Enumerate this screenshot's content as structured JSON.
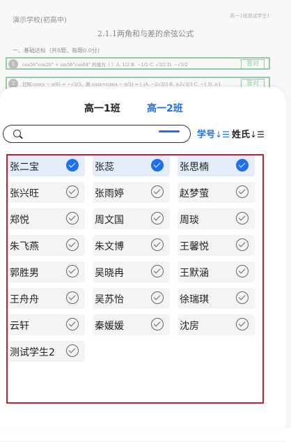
{
  "document": {
    "school": "演示学校(初高中)",
    "tag": "高一1班测试学生1",
    "title": "2.1.1两角和与差的余弦公式",
    "section": "一、基础达标（共8题，每题0.0分）",
    "questions": [
      {
        "num": "1",
        "text": "cos56°cos26° + sin56°cos64° 的值为（ ）A. 1/2  B. −1/2  C. √3/2  D. −√3/2",
        "answer": "答对"
      },
      {
        "num": "2",
        "text": "已知 cos(x − π/6) = −√3/3，则 cosx+cos(x − π/3) = ( )A. −2√3/3  B. ±2√3/3  C. −1  D. ±1",
        "answer": "答对"
      }
    ]
  },
  "tabs": [
    {
      "label": "高一1班",
      "active": false
    },
    {
      "label": "高一2班",
      "active": true
    }
  ],
  "search": {
    "value": "",
    "placeholder": ""
  },
  "sort": {
    "by_id_label": "学号",
    "by_name_label": "姓氏",
    "icon": "sort-descending-icon"
  },
  "colors": {
    "accent": "#1e6ff0",
    "selected_bg": "#e5edfb",
    "frame": "#c91e2e",
    "correct": "#3aa35a"
  },
  "students": [
    {
      "name": "张二宝",
      "selected": true
    },
    {
      "name": "张蕊",
      "selected": true
    },
    {
      "name": "张思楠",
      "selected": true
    },
    {
      "name": "张兴旺",
      "selected": false
    },
    {
      "name": "张雨婷",
      "selected": false
    },
    {
      "name": "赵梦萤",
      "selected": false
    },
    {
      "name": "郑悦",
      "selected": false
    },
    {
      "name": "周文国",
      "selected": false
    },
    {
      "name": "周琰",
      "selected": false
    },
    {
      "name": "朱飞燕",
      "selected": false
    },
    {
      "name": "朱文博",
      "selected": false
    },
    {
      "name": "王馨悦",
      "selected": false
    },
    {
      "name": "郭胜男",
      "selected": false
    },
    {
      "name": "吴晓冉",
      "selected": false
    },
    {
      "name": "王默涵",
      "selected": false
    },
    {
      "name": "王舟舟",
      "selected": false
    },
    {
      "name": "吴苏怡",
      "selected": false
    },
    {
      "name": "徐瑞琪",
      "selected": false
    },
    {
      "name": "云轩",
      "selected": false
    },
    {
      "name": "秦媛媛",
      "selected": false
    },
    {
      "name": "沈房",
      "selected": false
    },
    {
      "name": "测试学生2",
      "selected": false
    }
  ]
}
